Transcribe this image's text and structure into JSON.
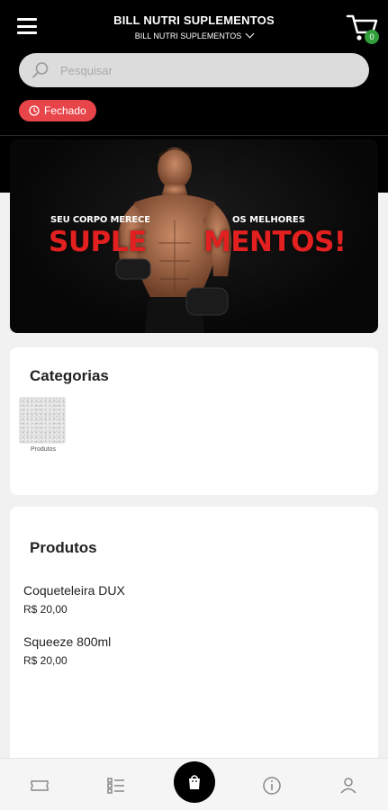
{
  "header": {
    "store_title": "BILL NUTRI SUPLEMENTOS",
    "store_selector": "BILL NUTRI SUPLEMENTOS",
    "cart_count": "0",
    "search_placeholder": "Pesquisar",
    "status": "Fechado"
  },
  "banner": {
    "line1_left": "SEU CORPO MERECE",
    "line1_right": "OS MELHORES",
    "big_left": "SUPLE",
    "big_right": "MENTOS!"
  },
  "categories": {
    "title": "Categorias",
    "items": [
      {
        "label": "Produtos"
      }
    ]
  },
  "products": {
    "title": "Produtos",
    "items": [
      {
        "name": "Coqueteleira DUX",
        "price": "R$ 20,00"
      },
      {
        "name": "Squeeze 800ml",
        "price": "R$ 20,00"
      }
    ]
  },
  "colors": {
    "status_red": "#e8454a",
    "badge_green": "#2f9e3b",
    "banner_red": "#e32020"
  },
  "icons": [
    "menu-icon",
    "cart-icon",
    "search-icon",
    "clock-icon",
    "ticket-icon",
    "list-icon",
    "bag-icon",
    "info-icon",
    "user-icon"
  ]
}
